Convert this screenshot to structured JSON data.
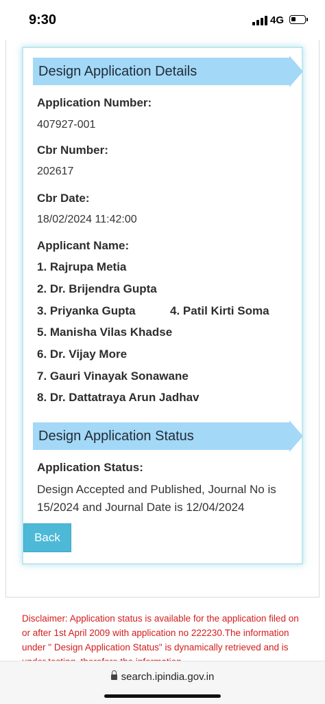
{
  "status_bar": {
    "time": "9:30",
    "network": "4G"
  },
  "details_section": {
    "title": "Design Application Details",
    "application_number_label": "Application Number:",
    "application_number": "407927-001",
    "cbr_number_label": "Cbr Number:",
    "cbr_number": "202617",
    "cbr_date_label": "Cbr Date:",
    "cbr_date": "18/02/2024 11:42:00",
    "applicant_name_label": "Applicant Name:",
    "applicants": [
      "1. Rajrupa Metia",
      "2. Dr. Brijendra Gupta",
      "3. Priyanka Gupta",
      "4. Patil Kirti Soma",
      "5. Manisha Vilas Khadse",
      "6. Dr. Vijay More",
      "7. Gauri Vinayak Sonawane",
      "8. Dr. Dattatraya Arun Jadhav"
    ]
  },
  "status_section": {
    "title": "Design Application Status",
    "application_status_label": "Application Status:",
    "application_status": "Design Accepted and Published, Journal No is 15/2024 and Journal Date is 12/04/2024"
  },
  "back_button": "Back",
  "disclaimer": "Disclaimer: Application status is available for the application filed on or after 1st April 2009 with application no 222230.The information under \" Design Application Status\" is dynamically retrieved and is under testing, therefore the information",
  "browser": {
    "url": "search.ipindia.gov.in"
  }
}
